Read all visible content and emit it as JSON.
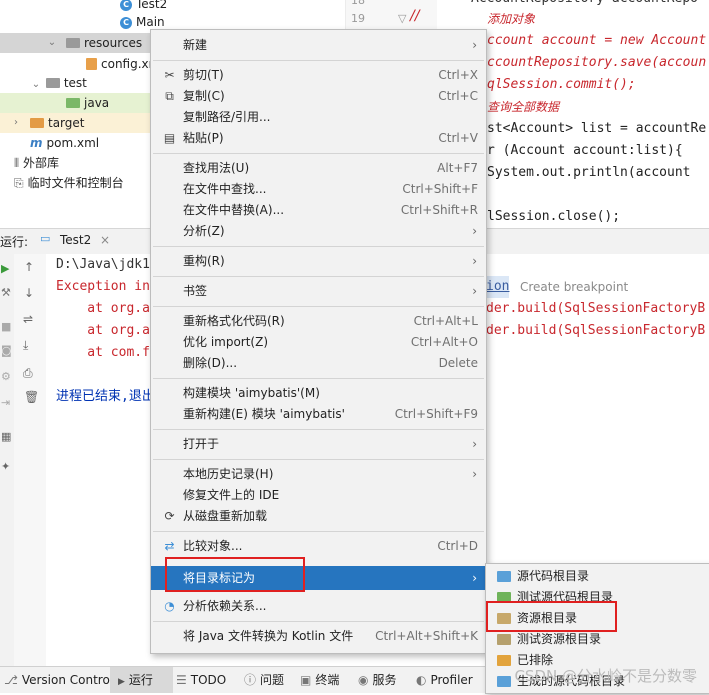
{
  "tree": {
    "items": [
      {
        "label": "Test2",
        "kind": "class"
      },
      {
        "label": "Main",
        "kind": "class"
      },
      {
        "label": "resources",
        "kind": "folder"
      },
      {
        "label": "config.xml",
        "kind": "file"
      },
      {
        "label": "test",
        "kind": "folder"
      },
      {
        "label": "java",
        "kind": "folder"
      },
      {
        "label": "target",
        "kind": "folder"
      },
      {
        "label": "pom.xml",
        "kind": "file"
      },
      {
        "label": "外部库",
        "kind": "library"
      },
      {
        "label": "临时文件和控制台",
        "kind": "scratch"
      }
    ]
  },
  "gutter": {
    "lines": [
      "18",
      "19"
    ]
  },
  "editor": {
    "lines": [
      "AccountRepository accountRepo",
      "添加对象",
      "ccount account = new Account",
      "ccountRepository.save(accoun",
      "qlSession.commit();",
      "查询全部数据",
      "st<Account> list = accountRe",
      "r (Account account:list){",
      "  System.out.println(account",
      "",
      "lSession.close();"
    ]
  },
  "run": {
    "label": "运行:",
    "tab": "Test2",
    "console": [
      "D:\\Java\\jdk1",
      "Exception in",
      "    at org.a",
      "    at org.a",
      "    at com.f",
      "",
      "进程已结束,退出"
    ],
    "right_lines": [
      "ion",
      "Create breakpoint",
      "der.build(SqlSessionFactoryB",
      "der.build(SqlSessionFactoryB"
    ]
  },
  "menu": {
    "items": [
      {
        "label": "新建",
        "shortcut": "",
        "arrow": true,
        "icon": ""
      },
      {
        "label": "剪切(T)",
        "shortcut": "Ctrl+X",
        "arrow": false,
        "icon": "✂"
      },
      {
        "label": "复制(C)",
        "shortcut": "Ctrl+C",
        "arrow": false,
        "icon": "⧉"
      },
      {
        "label": "复制路径/引用...",
        "shortcut": "",
        "arrow": false,
        "icon": ""
      },
      {
        "label": "粘贴(P)",
        "shortcut": "Ctrl+V",
        "arrow": false,
        "icon": "📋"
      },
      {
        "label": "查找用法(U)",
        "shortcut": "Alt+F7",
        "arrow": false,
        "icon": ""
      },
      {
        "label": "在文件中查找...",
        "shortcut": "Ctrl+Shift+F",
        "arrow": false,
        "icon": ""
      },
      {
        "label": "在文件中替换(A)...",
        "shortcut": "Ctrl+Shift+R",
        "arrow": false,
        "icon": ""
      },
      {
        "label": "分析(Z)",
        "shortcut": "",
        "arrow": true,
        "icon": ""
      },
      {
        "label": "重构(R)",
        "shortcut": "",
        "arrow": true,
        "icon": ""
      },
      {
        "label": "书签",
        "shortcut": "",
        "arrow": true,
        "icon": ""
      },
      {
        "label": "重新格式化代码(R)",
        "shortcut": "Ctrl+Alt+L",
        "arrow": false,
        "icon": ""
      },
      {
        "label": "优化 import(Z)",
        "shortcut": "Ctrl+Alt+O",
        "arrow": false,
        "icon": ""
      },
      {
        "label": "删除(D)...",
        "shortcut": "Delete",
        "arrow": false,
        "icon": ""
      },
      {
        "label": "构建模块 'aimybatis'(M)",
        "shortcut": "",
        "arrow": false,
        "icon": ""
      },
      {
        "label": "重新构建(E) 模块 'aimybatis'",
        "shortcut": "Ctrl+Shift+F9",
        "arrow": false,
        "icon": ""
      },
      {
        "label": "打开于",
        "shortcut": "",
        "arrow": true,
        "icon": ""
      },
      {
        "label": "本地历史记录(H)",
        "shortcut": "",
        "arrow": true,
        "icon": ""
      },
      {
        "label": "修复文件上的 IDE",
        "shortcut": "",
        "arrow": false,
        "icon": ""
      },
      {
        "label": "从磁盘重新加载",
        "shortcut": "",
        "arrow": false,
        "icon": "⟳"
      },
      {
        "label": "比较对象...",
        "shortcut": "Ctrl+D",
        "arrow": false,
        "icon": "⇄"
      },
      {
        "label": "将目录标记为",
        "shortcut": "",
        "arrow": true,
        "icon": ""
      },
      {
        "label": "分析依赖关系...",
        "shortcut": "",
        "arrow": false,
        "icon": "◔"
      },
      {
        "label": "将 Java 文件转换为 Kotlin 文件",
        "shortcut": "Ctrl+Alt+Shift+K",
        "arrow": false,
        "icon": ""
      }
    ]
  },
  "submenu": {
    "items": [
      {
        "label": "源代码根目录",
        "color": "#5aa0d8"
      },
      {
        "label": "测试源代码根目录",
        "color": "#6fb35a"
      },
      {
        "label": "资源根目录",
        "color": "#c7a86a"
      },
      {
        "label": "测试资源根目录",
        "color": "#b5a06d"
      },
      {
        "label": "已排除",
        "color": "#e2a33c"
      },
      {
        "label": "生成的源代码根目录",
        "color": "#5aa0d8"
      }
    ]
  },
  "statusbar": {
    "items": [
      "Version Control",
      "运行",
      "TODO",
      "问题",
      "终端",
      "服务",
      "Profiler"
    ]
  },
  "watermark": "CSDN @分水岭不是分数零",
  "colors": {
    "accent": "#2675bf",
    "highlight": "#e02020",
    "keyword": "#0033b3",
    "error": "#c8272d"
  }
}
